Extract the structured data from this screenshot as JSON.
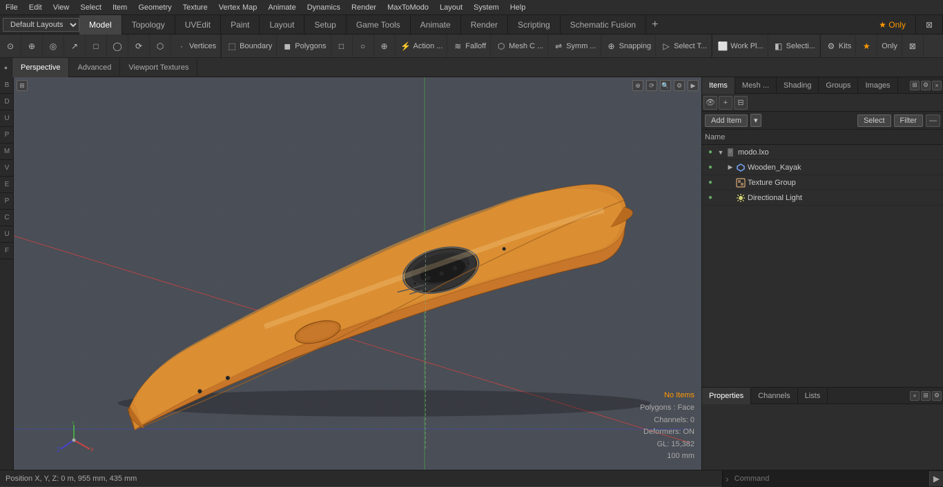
{
  "menu": {
    "items": [
      "File",
      "Edit",
      "View",
      "Select",
      "Item",
      "Geometry",
      "Texture",
      "Vertex Map",
      "Animate",
      "Dynamics",
      "Render",
      "MaxToModo",
      "Layout",
      "System",
      "Help"
    ]
  },
  "layout": {
    "selector": "Default Layouts ▾"
  },
  "tabs": {
    "items": [
      "Model",
      "Topology",
      "UVEdit",
      "Paint",
      "Layout",
      "Setup",
      "Game Tools",
      "Animate",
      "Render",
      "Scripting",
      "Schematic Fusion"
    ],
    "active": "Model",
    "add_icon": "+"
  },
  "toolbar": {
    "buttons": [
      {
        "label": "",
        "icon": "⊙",
        "name": "perspective-icon"
      },
      {
        "label": "",
        "icon": "⊕",
        "name": "grid-icon"
      },
      {
        "label": "",
        "icon": "◎",
        "name": "snap-icon"
      },
      {
        "label": "",
        "icon": "↗",
        "name": "arrow-icon"
      },
      {
        "label": "",
        "icon": "□",
        "name": "select-rect-icon"
      },
      {
        "label": "",
        "icon": "◯",
        "name": "select-circle-icon"
      },
      {
        "label": "",
        "icon": "⟳",
        "name": "rotate-icon"
      },
      {
        "label": "",
        "icon": "⬡",
        "name": "mesh-icon"
      },
      {
        "label": "Vertices",
        "icon": "·",
        "name": "vertices-btn"
      },
      {
        "label": "",
        "icon": "|",
        "name": "sep1"
      },
      {
        "label": "Boundary",
        "icon": "⬚",
        "name": "boundary-btn"
      },
      {
        "label": "Polygons",
        "icon": "◼",
        "name": "polygons-btn"
      },
      {
        "label": "",
        "icon": "□",
        "name": "box-btn"
      },
      {
        "label": "",
        "icon": "○",
        "name": "circ-btn"
      },
      {
        "label": "",
        "icon": "⊕",
        "name": "plus-btn"
      },
      {
        "label": "Action ...",
        "icon": "⚡",
        "name": "action-btn"
      },
      {
        "label": "Falloff",
        "icon": "≋",
        "name": "falloff-btn"
      },
      {
        "label": "Mesh C ...",
        "icon": "⬡",
        "name": "mesh-c-btn"
      },
      {
        "label": "Symm ...",
        "icon": "⇌",
        "name": "symm-btn"
      },
      {
        "label": "Snapping",
        "icon": "⊕",
        "name": "snapping-btn"
      },
      {
        "label": "Select T...",
        "icon": "▷",
        "name": "select-t-btn"
      },
      {
        "label": "",
        "icon": "|",
        "name": "sep2"
      },
      {
        "label": "Work Pl...",
        "icon": "⬜",
        "name": "work-pl-btn"
      },
      {
        "label": "Selecti...",
        "icon": "◧",
        "name": "selecti-btn"
      },
      {
        "label": "",
        "icon": "|",
        "name": "sep3"
      },
      {
        "label": "Kits",
        "icon": "⚙",
        "name": "kits-btn"
      },
      {
        "label": "",
        "icon": "★",
        "name": "star-btn"
      },
      {
        "label": "Only",
        "icon": "",
        "name": "only-btn"
      },
      {
        "label": "",
        "icon": "⊠",
        "name": "extra-btn"
      }
    ]
  },
  "subtoolbar": {
    "tabs": [
      "Perspective",
      "Advanced",
      "Viewport Textures"
    ]
  },
  "left_panel": {
    "buttons": [
      "B",
      "D",
      "U",
      "P",
      "M",
      "V",
      "E",
      "P",
      "C",
      "U",
      "F"
    ]
  },
  "viewport": {
    "bg_color": "#4a4e55",
    "status": {
      "no_items": "No Items",
      "polygons": "Polygons : Face",
      "channels": "Channels: 0",
      "deformers": "Deformers: ON",
      "gl": "GL: 15,382",
      "size": "100 mm"
    }
  },
  "items_panel": {
    "tabs": [
      "Items",
      "Mesh ...",
      "Shading",
      "Groups",
      "Images"
    ],
    "toolbar_icons": [
      "+",
      "◎",
      "⊟"
    ],
    "add_item_label": "Add Item",
    "add_item_arrow": "▾",
    "select_label": "Select",
    "filter_label": "Filter",
    "col_name": "Name",
    "items": [
      {
        "id": "modo-lxo",
        "level": 0,
        "label": "modo.lxo",
        "icon": "🗋",
        "expandable": true,
        "expanded": true,
        "vis": true
      },
      {
        "id": "wooden-kayak",
        "level": 1,
        "label": "Wooden_Kayak",
        "icon": "⬡",
        "expandable": true,
        "expanded": false,
        "vis": true
      },
      {
        "id": "texture-group",
        "level": 1,
        "label": "Texture Group",
        "icon": "🎨",
        "expandable": false,
        "expanded": false,
        "vis": true
      },
      {
        "id": "directional-light",
        "level": 1,
        "label": "Directional Light",
        "icon": "💡",
        "expandable": false,
        "expanded": false,
        "vis": true
      }
    ]
  },
  "properties_panel": {
    "tabs": [
      "Properties",
      "Channels",
      "Lists"
    ],
    "add_icon": "+"
  },
  "bottom_bar": {
    "position_text": "Position X, Y, Z:  0 m, 955 mm, 435 mm",
    "command_placeholder": "Command",
    "separator": "›"
  }
}
